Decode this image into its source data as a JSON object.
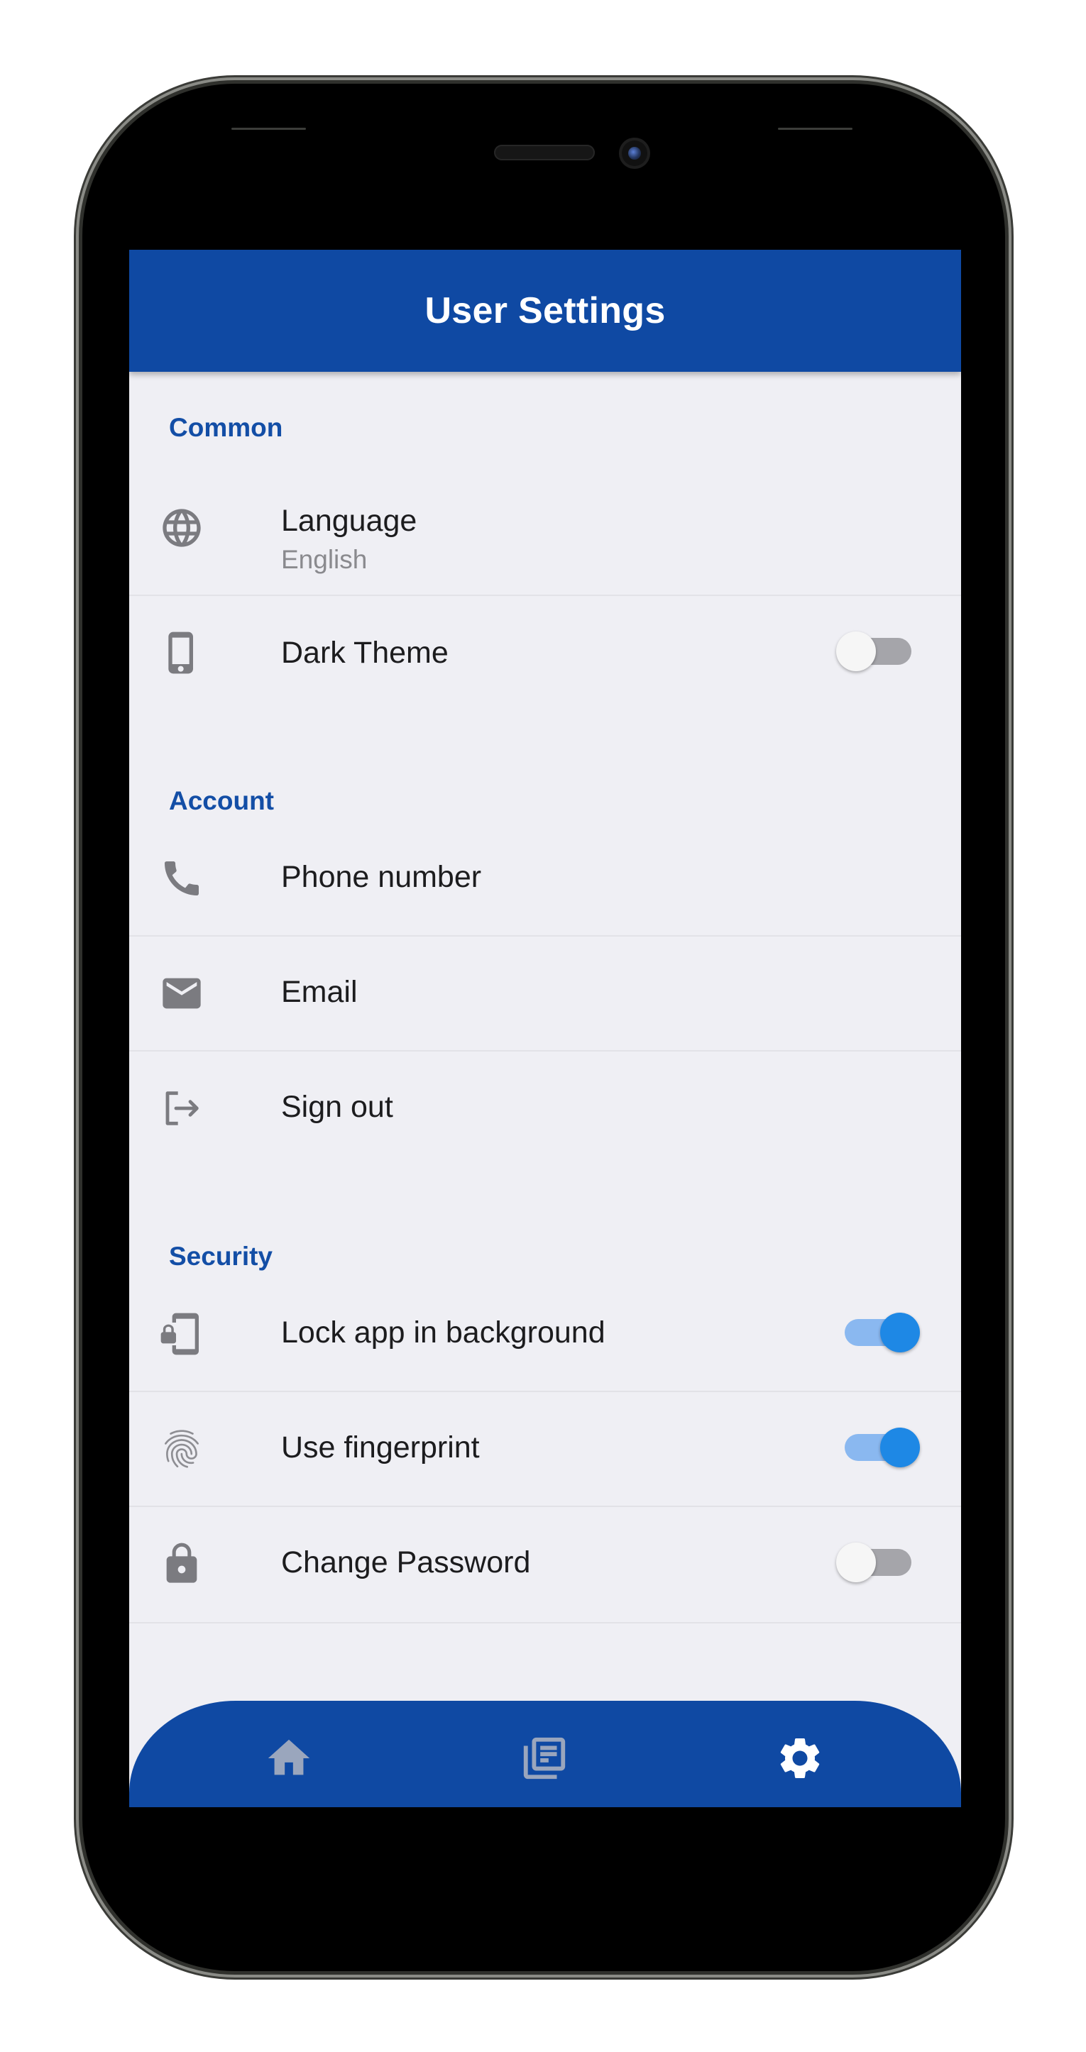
{
  "app_bar": {
    "title": "User Settings"
  },
  "sections": {
    "common": {
      "title": "Common"
    },
    "account": {
      "title": "Account"
    },
    "security": {
      "title": "Security"
    }
  },
  "tiles": {
    "language": {
      "label": "Language",
      "value": "English",
      "icon": "globe-icon"
    },
    "dark_theme": {
      "label": "Dark Theme",
      "icon": "phone-device-icon",
      "enabled": false
    },
    "phone_number": {
      "label": "Phone number",
      "icon": "phone-icon"
    },
    "email": {
      "label": "Email",
      "icon": "mail-icon"
    },
    "sign_out": {
      "label": "Sign out",
      "icon": "logout-icon"
    },
    "lock_app": {
      "label": "Lock app in background",
      "icon": "phonelink-lock-icon",
      "enabled": true
    },
    "fingerprint": {
      "label": "Use fingerprint",
      "icon": "fingerprint-icon",
      "enabled": true
    },
    "change_password": {
      "label": "Change Password",
      "icon": "lock-icon",
      "enabled": false
    }
  },
  "bottom_nav": {
    "items": [
      {
        "icon": "home-icon",
        "active": false
      },
      {
        "icon": "article-icon",
        "active": false
      },
      {
        "icon": "settings-gear-icon",
        "active": true
      }
    ]
  },
  "colors": {
    "primary": "#0f49a3",
    "section_title": "#134ea6",
    "switch_on": "#1e88e5",
    "background": "#efeff4"
  }
}
